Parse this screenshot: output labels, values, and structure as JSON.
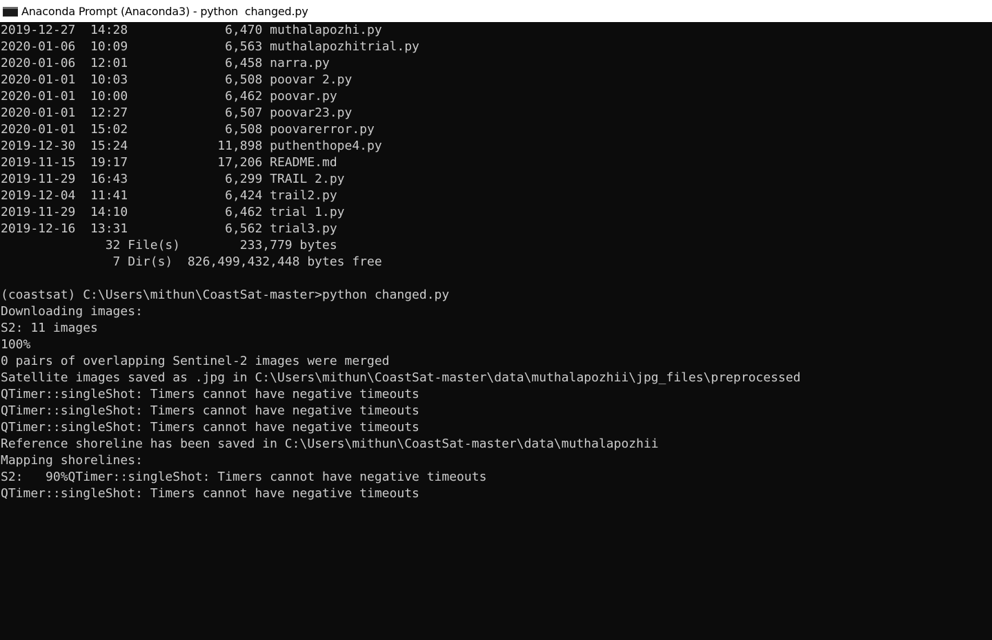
{
  "window": {
    "title": "Anaconda Prompt (Anaconda3) - python  changed.py",
    "icon": "console-icon"
  },
  "colors": {
    "background": "#0c0c0c",
    "foreground": "#cccccc",
    "titlebar": "#ffffff"
  },
  "console": {
    "lines": [
      "2019-12-27  14:28             6,470 muthalapozhi.py",
      "2020-01-06  10:09             6,563 muthalapozhitrial.py",
      "2020-01-06  12:01             6,458 narra.py",
      "2020-01-01  10:03             6,508 poovar 2.py",
      "2020-01-01  10:00             6,462 poovar.py",
      "2020-01-01  12:27             6,507 poovar23.py",
      "2020-01-01  15:02             6,508 poovarerror.py",
      "2019-12-30  15:24            11,898 puthenthope4.py",
      "2019-11-15  19:17            17,206 README.md",
      "2019-11-29  16:43             6,299 TRAIL 2.py",
      "2019-12-04  11:41             6,424 trail2.py",
      "2019-11-29  14:10             6,462 trial 1.py",
      "2019-12-16  13:31             6,562 trial3.py",
      "              32 File(s)        233,779 bytes",
      "               7 Dir(s)  826,499,432,448 bytes free",
      "",
      "(coastsat) C:\\Users\\mithun\\CoastSat-master>python changed.py",
      "Downloading images:",
      "S2: 11 images",
      "100%",
      "0 pairs of overlapping Sentinel-2 images were merged",
      "Satellite images saved as .jpg in C:\\Users\\mithun\\CoastSat-master\\data\\muthalapozhii\\jpg_files\\preprocessed",
      "QTimer::singleShot: Timers cannot have negative timeouts",
      "QTimer::singleShot: Timers cannot have negative timeouts",
      "QTimer::singleShot: Timers cannot have negative timeouts",
      "Reference shoreline has been saved in C:\\Users\\mithun\\CoastSat-master\\data\\muthalapozhii",
      "Mapping shorelines:",
      "S2:   90%QTimer::singleShot: Timers cannot have negative timeouts",
      "QTimer::singleShot: Timers cannot have negative timeouts"
    ]
  }
}
